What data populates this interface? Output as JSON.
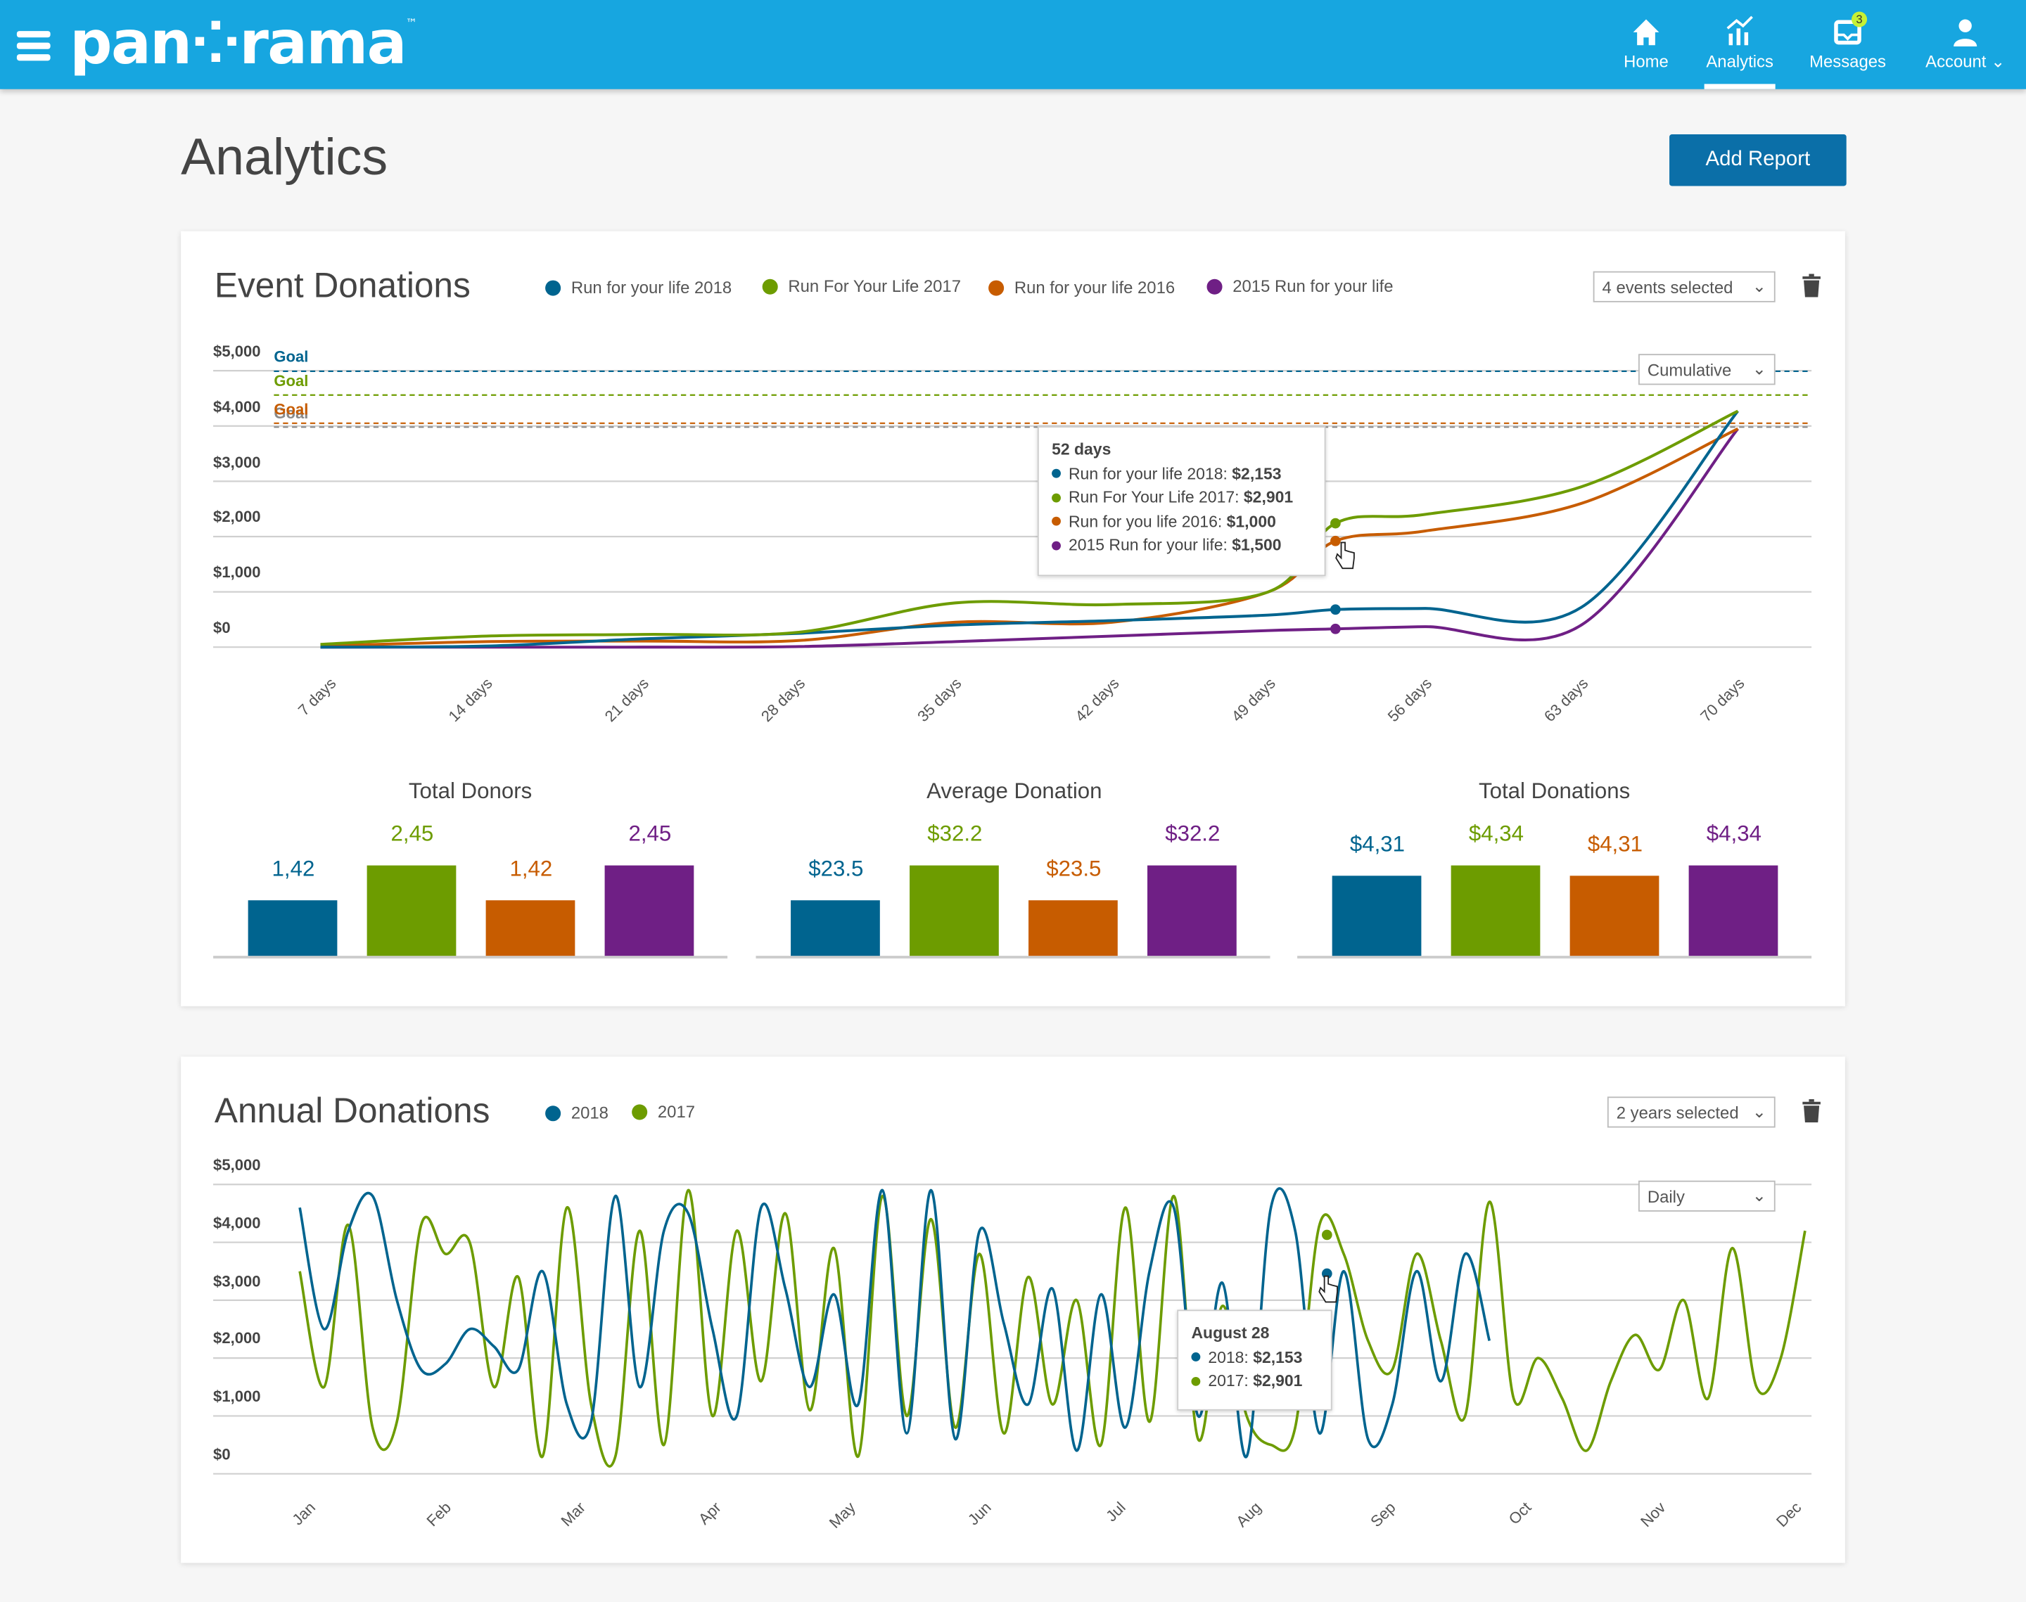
{
  "header": {
    "logo": "pan⁘rama",
    "trademark": "™",
    "nav": [
      {
        "label": "Home",
        "icon": "home-icon"
      },
      {
        "label": "Analytics",
        "icon": "analytics-icon",
        "active": true
      },
      {
        "label": "Messages",
        "icon": "messages-icon",
        "badge": "3"
      },
      {
        "label": "Account",
        "icon": "user-icon"
      }
    ],
    "brand_color": "#17a6e0"
  },
  "page": {
    "title": "Analytics",
    "add_report": "Add Report"
  },
  "colors": {
    "s2018": "#00648f",
    "s2017": "#6d9c00",
    "s2016": "#c75c00",
    "s2015": "#6f1f85",
    "goal_gray": "#8a8a8a"
  },
  "event": {
    "title": "Event Donations",
    "legend": [
      "Run for your life 2018",
      "Run For Your Life 2017",
      "Run for your life 2016",
      "2015 Run for your life"
    ],
    "select": "4 events selected",
    "mode": "Cumulative",
    "goal_label": "Goal",
    "tooltip": {
      "title": "52 days",
      "rows": [
        {
          "label": "Run for your life 2018:",
          "value": "$2,153"
        },
        {
          "label": "Run For Your Life 2017:",
          "value": "$2,901"
        },
        {
          "label": "Run for you life 2016:",
          "value": "$1,000"
        },
        {
          "label": "2015 Run for your life:",
          "value": "$1,500"
        }
      ]
    },
    "bars": [
      {
        "title": "Total Donors",
        "labels": [
          "1,42",
          "2,45",
          "1,42",
          "2,45"
        ],
        "values": [
          1.42,
          2.45,
          1.42,
          2.45
        ]
      },
      {
        "title": "Average Donation",
        "labels": [
          "$23.5",
          "$32.2",
          "$23.5",
          "$32.2"
        ],
        "values": [
          23.5,
          32.2,
          23.5,
          32.2
        ]
      },
      {
        "title": "Total Donations",
        "labels": [
          "$4,31",
          "$4,34",
          "$4,31",
          "$4,34"
        ],
        "values": [
          4.31,
          4.34,
          4.31,
          4.34
        ]
      }
    ]
  },
  "annual": {
    "title": "Annual Donations",
    "legend": [
      "2018",
      "2017"
    ],
    "select": "2 years selected",
    "mode": "Daily",
    "tooltip": {
      "title": "August 28",
      "rows": [
        {
          "label": "2018:",
          "value": "$2,153"
        },
        {
          "label": "2017:",
          "value": "$2,901"
        }
      ]
    }
  },
  "chart_data": [
    {
      "type": "line",
      "title": "Event Donations",
      "y_ticks": [
        "$0",
        "$1,000",
        "$2,000",
        "$3,000",
        "$4,000",
        "$5,000"
      ],
      "ylim": [
        0,
        5000
      ],
      "x_ticks": [
        "7 days",
        "14 days",
        "21 days",
        "28 days",
        "35 days",
        "42 days",
        "49 days",
        "56 days",
        "63 days",
        "70 days"
      ],
      "x": [
        7,
        14,
        21,
        28,
        35,
        42,
        49,
        52,
        56,
        63,
        70
      ],
      "series": [
        {
          "name": "Run for your life 2018",
          "values": [
            0,
            20,
            150,
            250,
            400,
            480,
            580,
            680,
            700,
            720,
            4270
          ],
          "goal": 4990
        },
        {
          "name": "Run For Your Life 2017",
          "values": [
            50,
            200,
            230,
            270,
            800,
            770,
            1000,
            2240,
            2400,
            2900,
            4270
          ],
          "goal": 4560
        },
        {
          "name": "Run for your life 2016",
          "values": [
            20,
            100,
            110,
            120,
            450,
            450,
            1000,
            1920,
            2100,
            2600,
            3950
          ],
          "goal": 4050
        },
        {
          "name": "2015 Run for your life",
          "values": [
            0,
            0,
            0,
            10,
            100,
            200,
            300,
            330,
            370,
            400,
            3950
          ],
          "goal": 3980
        }
      ],
      "highlight_x": 52
    },
    {
      "type": "line",
      "title": "Annual Donations",
      "y_ticks": [
        "$0",
        "$1,000",
        "$2,000",
        "$3,000",
        "$4,000",
        "$5,000"
      ],
      "ylim": [
        0,
        5000
      ],
      "x_ticks": [
        "Jan",
        "Feb",
        "Mar",
        "Apr",
        "May",
        "Jun",
        "Jul",
        "Aug",
        "Sep",
        "Oct",
        "Nov",
        "Dec"
      ],
      "series": [
        {
          "name": "2018",
          "values": [
            4600,
            2500,
            4200,
            4800,
            3000,
            1800,
            1900,
            2500,
            2200,
            1800,
            3500,
            1200,
            900,
            4800,
            1500,
            4200,
            4500,
            2500,
            1000,
            4600,
            3200,
            1500,
            3100,
            1200,
            4900,
            700,
            4900,
            600,
            4200,
            2600,
            1200,
            3200,
            400,
            3100,
            800,
            3500,
            4600,
            1000,
            3300,
            300,
            4600,
            4200,
            700,
            3500,
            600,
            1200,
            3500,
            1600,
            3800,
            2300
          ]
        },
        {
          "name": "2017",
          "values": [
            3500,
            1500,
            4300,
            800,
            900,
            4300,
            3800,
            4000,
            1500,
            3400,
            300,
            4600,
            1200,
            300,
            4200,
            500,
            4900,
            1000,
            4200,
            1600,
            4500,
            1100,
            3900,
            300,
            4800,
            1000,
            4400,
            800,
            3800,
            700,
            3400,
            1200,
            3000,
            500,
            4600,
            900,
            4800,
            600,
            2900,
            1000,
            500,
            800,
            4300,
            3800,
            2300,
            1800,
            3800,
            2300,
            1000,
            4700,
            1300,
            2000,
            1300,
            400,
            1600,
            2400,
            1800,
            3000,
            1300,
            3900,
            1500,
            2000,
            4200
          ]
        }
      ]
    }
  ]
}
